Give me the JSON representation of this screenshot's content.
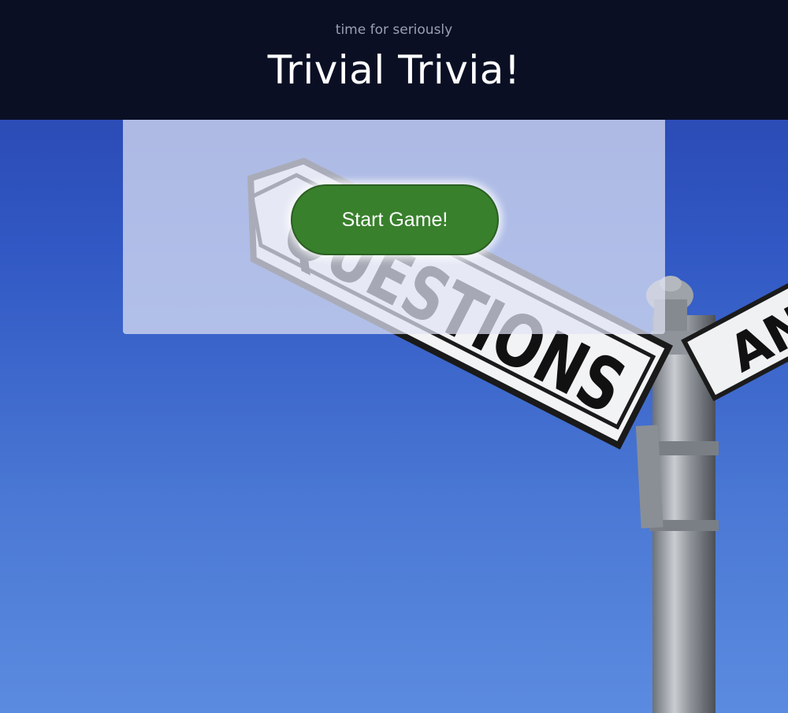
{
  "header": {
    "tagline": "time for seriously",
    "title": "Trivial Trivia!"
  },
  "main": {
    "start_button_label": "Start Game!"
  },
  "background": {
    "sign_main_text": "QUESTIONS",
    "sign_secondary_text": "AN",
    "sky_color": "#3158c4"
  },
  "colors": {
    "header_bg": "#0a0f24",
    "button_bg": "#38802c",
    "panel_bg": "#e1e4f5"
  }
}
